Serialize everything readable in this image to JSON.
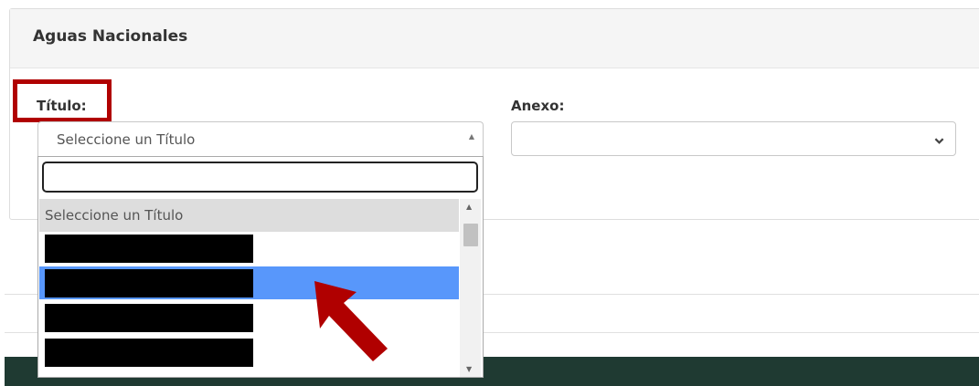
{
  "section": {
    "title": "Aguas Nacionales"
  },
  "titulo": {
    "label": "Título:",
    "selected_text": "Seleccione un Título",
    "search_value": "",
    "options": [
      {
        "label": "Seleccione un Título"
      },
      {
        "label": "",
        "redacted": true
      },
      {
        "label": "",
        "redacted": true,
        "highlighted": true
      },
      {
        "label": "",
        "redacted": true
      },
      {
        "label": "",
        "redacted": true
      }
    ]
  },
  "anexo": {
    "label": "Anexo:",
    "selected_text": ""
  },
  "colors": {
    "highlight_box": "#b00000",
    "selected_option": "#5897fb",
    "footer": "#1f3a32",
    "pointer_arrow": "#b00000"
  },
  "icons": {
    "select_open": "caret-up-icon",
    "anexo_select": "chevron-down-icon",
    "scroll_up": "scroll-up-icon",
    "scroll_down": "scroll-down-icon",
    "annotation": "red-arrow-icon"
  }
}
